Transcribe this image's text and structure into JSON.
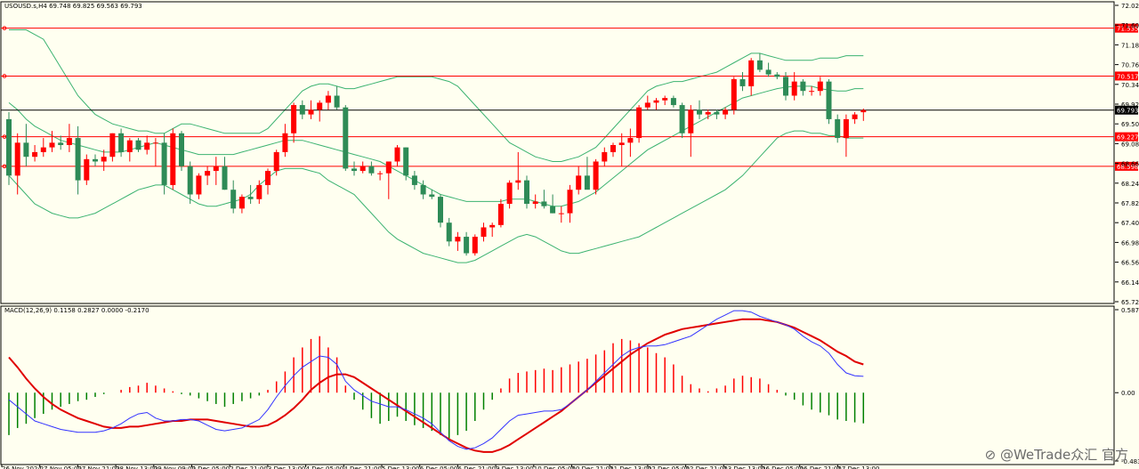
{
  "chart_data": {
    "type": "candlestick",
    "header": "USOUSD.s,H4  69.748 69.825 69.563 69.793",
    "colors": {
      "up": "#ff0000",
      "down": "#2e8b57",
      "bands": "#3cb371",
      "level": "#ff0000",
      "price_line": "#000000",
      "background": "#fffff0"
    },
    "price_axis": {
      "ylim": [
        65.72,
        72.02
      ],
      "ticks": [
        "72.020",
        "71.600",
        "71.180",
        "70.760",
        "70.340",
        "69.920",
        "69.500",
        "69.080",
        "68.660",
        "68.240",
        "67.820",
        "67.400",
        "66.980",
        "66.560",
        "66.140",
        "65.720"
      ]
    },
    "levels": [
      71.535,
      70.517,
      69.227,
      68.598
    ],
    "level_labels": [
      "71.535",
      "70.517",
      "69.227",
      "68.598"
    ],
    "last_price": 69.793,
    "last_price_label": "69.793",
    "x_labels": [
      "26 Nov 2024",
      "27 Nov 05:00",
      "27 Nov 21:00",
      "28 Nov 13:00",
      "29 Nov 09:00",
      "2 Dec 05:00",
      "2 Dec 21:00",
      "3 Dec 13:00",
      "4 Dec 05:00",
      "4 Dec 21:00",
      "5 Dec 13:00",
      "6 Dec 05:00",
      "6 Dec 21:00",
      "9 Dec 13:00",
      "10 Dec 05:00",
      "10 Dec 21:00",
      "11 Dec 13:00",
      "12 Dec 05:00",
      "12 Dec 21:00",
      "13 Dec 13:00",
      "16 Dec 05:00",
      "16 Dec 21:00",
      "17 Dec 13:00"
    ],
    "candles": [
      [
        69.6,
        69.75,
        68.2,
        68.4
      ],
      [
        68.4,
        69.3,
        68.0,
        69.1
      ],
      [
        69.1,
        69.5,
        68.6,
        68.8
      ],
      [
        68.8,
        69.05,
        68.7,
        68.9
      ],
      [
        68.9,
        69.2,
        68.8,
        69.0
      ],
      [
        69.0,
        69.35,
        68.9,
        69.1
      ],
      [
        69.1,
        69.25,
        68.95,
        69.05
      ],
      [
        69.05,
        69.5,
        68.9,
        69.2
      ],
      [
        69.2,
        69.45,
        68.0,
        68.3
      ],
      [
        68.3,
        68.85,
        68.2,
        68.75
      ],
      [
        68.75,
        68.85,
        68.6,
        68.7
      ],
      [
        68.7,
        68.95,
        68.5,
        68.8
      ],
      [
        68.8,
        69.3,
        68.7,
        69.3
      ],
      [
        69.3,
        69.4,
        68.8,
        68.9
      ],
      [
        68.9,
        69.2,
        68.7,
        69.15
      ],
      [
        69.15,
        69.2,
        68.9,
        68.95
      ],
      [
        68.95,
        69.25,
        68.85,
        69.1
      ],
      [
        69.1,
        69.2,
        68.6,
        69.1
      ],
      [
        69.1,
        69.3,
        68.0,
        68.2
      ],
      [
        68.2,
        69.4,
        68.1,
        69.3
      ],
      [
        69.3,
        69.35,
        68.5,
        68.6
      ],
      [
        68.6,
        68.7,
        67.8,
        68.0
      ],
      [
        68.0,
        68.45,
        67.9,
        68.4
      ],
      [
        68.4,
        68.6,
        68.2,
        68.5
      ],
      [
        68.5,
        68.8,
        68.2,
        68.6
      ],
      [
        68.6,
        68.8,
        68.1,
        68.1
      ],
      [
        68.1,
        68.3,
        67.6,
        67.7
      ],
      [
        67.7,
        68.0,
        67.6,
        67.95
      ],
      [
        67.95,
        68.2,
        67.8,
        67.9
      ],
      [
        67.9,
        68.3,
        67.8,
        68.2
      ],
      [
        68.2,
        68.55,
        68.0,
        68.5
      ],
      [
        68.5,
        68.95,
        68.4,
        68.9
      ],
      [
        68.9,
        69.5,
        68.8,
        69.3
      ],
      [
        69.3,
        69.95,
        69.1,
        69.9
      ],
      [
        69.9,
        70.0,
        69.6,
        69.7
      ],
      [
        69.7,
        70.0,
        69.6,
        69.8
      ],
      [
        69.8,
        70.0,
        69.55,
        69.95
      ],
      [
        69.95,
        70.2,
        69.8,
        70.1
      ],
      [
        70.1,
        70.3,
        69.8,
        69.85
      ],
      [
        69.85,
        69.9,
        68.5,
        68.55
      ],
      [
        68.55,
        68.7,
        68.4,
        68.5
      ],
      [
        68.5,
        68.7,
        68.45,
        68.6
      ],
      [
        68.6,
        68.7,
        68.4,
        68.45
      ],
      [
        68.45,
        68.5,
        68.3,
        68.45
      ],
      [
        68.45,
        68.6,
        67.9,
        68.7
      ],
      [
        68.7,
        69.05,
        68.6,
        69.0
      ],
      [
        69.0,
        69.0,
        68.3,
        68.4
      ],
      [
        68.4,
        68.5,
        68.1,
        68.2
      ],
      [
        68.2,
        68.3,
        67.9,
        68.0
      ],
      [
        68.0,
        68.1,
        67.9,
        67.95
      ],
      [
        67.95,
        68.0,
        67.3,
        67.4
      ],
      [
        67.4,
        67.5,
        66.9,
        67.0
      ],
      [
        67.0,
        67.2,
        66.8,
        67.1
      ],
      [
        67.1,
        67.2,
        66.7,
        66.75
      ],
      [
        66.75,
        67.15,
        66.7,
        67.1
      ],
      [
        67.1,
        67.4,
        67.0,
        67.3
      ],
      [
        67.3,
        67.4,
        67.1,
        67.35
      ],
      [
        67.35,
        67.9,
        67.3,
        67.8
      ],
      [
        67.8,
        68.3,
        67.7,
        68.25
      ],
      [
        68.25,
        68.9,
        68.1,
        68.3
      ],
      [
        68.3,
        68.4,
        67.7,
        67.8
      ],
      [
        67.8,
        68.0,
        67.7,
        67.85
      ],
      [
        67.85,
        68.1,
        67.7,
        67.75
      ],
      [
        67.75,
        68.0,
        67.6,
        67.6
      ],
      [
        67.6,
        67.75,
        67.4,
        67.6
      ],
      [
        67.6,
        68.2,
        67.4,
        68.1
      ],
      [
        68.1,
        68.6,
        68.0,
        68.4
      ],
      [
        68.4,
        68.8,
        68.2,
        68.1
      ],
      [
        68.1,
        68.75,
        68.0,
        68.7
      ],
      [
        68.7,
        69.0,
        68.6,
        68.9
      ],
      [
        68.9,
        69.1,
        68.8,
        69.05
      ],
      [
        69.05,
        69.3,
        68.6,
        69.1
      ],
      [
        69.1,
        69.4,
        68.8,
        69.2
      ],
      [
        69.2,
        69.9,
        69.1,
        69.85
      ],
      [
        69.85,
        70.1,
        69.8,
        69.95
      ],
      [
        69.95,
        70.05,
        69.8,
        70.0
      ],
      [
        70.0,
        70.1,
        69.9,
        70.05
      ],
      [
        70.05,
        70.1,
        69.85,
        69.9
      ],
      [
        69.9,
        69.95,
        69.2,
        69.3
      ],
      [
        69.3,
        69.9,
        68.8,
        69.8
      ],
      [
        69.8,
        70.0,
        69.6,
        69.7
      ],
      [
        69.7,
        69.8,
        69.6,
        69.75
      ],
      [
        69.75,
        69.8,
        69.6,
        69.7
      ],
      [
        69.7,
        69.85,
        69.6,
        69.8
      ],
      [
        69.8,
        70.5,
        69.7,
        70.45
      ],
      [
        70.45,
        70.6,
        70.2,
        70.3
      ],
      [
        70.3,
        70.9,
        70.1,
        70.85
      ],
      [
        70.85,
        71.0,
        70.6,
        70.65
      ],
      [
        70.65,
        70.8,
        70.5,
        70.55
      ],
      [
        70.55,
        70.6,
        70.45,
        70.5
      ],
      [
        70.5,
        70.6,
        70.0,
        70.1
      ],
      [
        70.1,
        70.6,
        70.0,
        70.4
      ],
      [
        70.4,
        70.45,
        70.1,
        70.2
      ],
      [
        70.2,
        70.3,
        70.1,
        70.2
      ],
      [
        70.2,
        70.5,
        70.1,
        70.4
      ],
      [
        70.4,
        70.45,
        69.5,
        69.6
      ],
      [
        69.6,
        69.7,
        69.1,
        69.2
      ],
      [
        69.2,
        69.7,
        68.8,
        69.6
      ],
      [
        69.6,
        69.75,
        69.5,
        69.7
      ],
      [
        69.748,
        69.825,
        69.563,
        69.793
      ]
    ],
    "bollinger": {
      "upper": [
        71.5,
        71.5,
        71.5,
        71.4,
        71.3,
        71.0,
        70.7,
        70.4,
        70.1,
        69.9,
        69.7,
        69.6,
        69.5,
        69.45,
        69.4,
        69.35,
        69.35,
        69.3,
        69.3,
        69.4,
        69.5,
        69.5,
        69.45,
        69.4,
        69.35,
        69.3,
        69.3,
        69.3,
        69.3,
        69.3,
        69.4,
        69.6,
        69.8,
        70.0,
        70.2,
        70.3,
        70.35,
        70.35,
        70.3,
        70.25,
        70.25,
        70.3,
        70.35,
        70.4,
        70.45,
        70.5,
        70.5,
        70.5,
        70.5,
        70.5,
        70.45,
        70.4,
        70.3,
        70.1,
        69.9,
        69.7,
        69.5,
        69.3,
        69.1,
        69.0,
        68.9,
        68.8,
        68.75,
        68.7,
        68.7,
        68.75,
        68.8,
        68.9,
        69.0,
        69.2,
        69.4,
        69.6,
        69.8,
        70.0,
        70.2,
        70.3,
        70.35,
        70.4,
        70.4,
        70.45,
        70.5,
        70.55,
        70.6,
        70.7,
        70.8,
        70.9,
        71.0,
        71.0,
        70.95,
        70.9,
        70.85,
        70.85,
        70.85,
        70.85,
        70.9,
        70.9,
        70.9,
        70.95,
        70.95,
        70.95
      ],
      "middle": [
        69.95,
        69.8,
        69.6,
        69.45,
        69.35,
        69.25,
        69.15,
        69.1,
        69.05,
        69.0,
        68.95,
        68.9,
        68.9,
        68.9,
        68.95,
        69.0,
        69.05,
        69.1,
        69.05,
        69.0,
        68.95,
        68.9,
        68.85,
        68.85,
        68.85,
        68.85,
        68.85,
        68.9,
        68.95,
        69.0,
        69.05,
        69.1,
        69.15,
        69.15,
        69.15,
        69.1,
        69.05,
        69.0,
        68.95,
        68.9,
        68.85,
        68.8,
        68.75,
        68.7,
        68.6,
        68.5,
        68.4,
        68.3,
        68.2,
        68.1,
        68.0,
        67.95,
        67.9,
        67.85,
        67.85,
        67.85,
        67.85,
        67.85,
        67.9,
        67.9,
        67.9,
        67.85,
        67.8,
        67.75,
        67.75,
        67.8,
        67.85,
        67.95,
        68.05,
        68.2,
        68.35,
        68.5,
        68.65,
        68.8,
        68.95,
        69.05,
        69.15,
        69.25,
        69.35,
        69.45,
        69.55,
        69.65,
        69.75,
        69.85,
        69.95,
        70.05,
        70.1,
        70.15,
        70.2,
        70.25,
        70.28,
        70.3,
        70.3,
        70.3,
        70.25,
        70.22,
        70.2,
        70.2,
        70.25,
        70.25
      ],
      "lower": [
        68.4,
        68.2,
        68.0,
        67.8,
        67.7,
        67.6,
        67.55,
        67.5,
        67.5,
        67.55,
        67.6,
        67.7,
        67.8,
        67.9,
        68.0,
        68.1,
        68.15,
        68.2,
        68.2,
        68.1,
        68.0,
        67.9,
        67.8,
        67.75,
        67.75,
        67.8,
        67.85,
        67.9,
        68.0,
        68.2,
        68.35,
        68.5,
        68.55,
        68.55,
        68.55,
        68.5,
        68.45,
        68.3,
        68.2,
        68.1,
        68.0,
        67.8,
        67.6,
        67.4,
        67.2,
        67.05,
        66.95,
        66.85,
        66.75,
        66.7,
        66.65,
        66.6,
        66.55,
        66.55,
        66.6,
        66.7,
        66.8,
        66.9,
        67.0,
        67.1,
        67.15,
        67.1,
        67.0,
        66.9,
        66.8,
        66.75,
        66.75,
        66.8,
        66.85,
        66.9,
        66.95,
        67.0,
        67.05,
        67.1,
        67.2,
        67.3,
        67.4,
        67.5,
        67.6,
        67.7,
        67.8,
        67.9,
        68.0,
        68.1,
        68.25,
        68.4,
        68.6,
        68.8,
        69.0,
        69.2,
        69.3,
        69.35,
        69.35,
        69.3,
        69.3,
        69.25,
        69.25,
        69.2,
        69.2,
        69.2
      ]
    },
    "macd": {
      "header": "MACD(12,26,9) 0.1158 0.2827 0.0000 -0.2170",
      "ylim": [
        -0.4834,
        0.5872
      ],
      "ticks": [
        "0.5872",
        "0.00",
        "-0.4834"
      ],
      "histogram": [
        -0.3,
        -0.25,
        -0.22,
        -0.18,
        -0.15,
        -0.12,
        -0.1,
        -0.08,
        -0.06,
        -0.05,
        -0.03,
        -0.01,
        0.0,
        0.02,
        0.04,
        0.05,
        0.07,
        0.05,
        0.03,
        0.01,
        -0.01,
        -0.02,
        -0.04,
        -0.06,
        -0.08,
        -0.1,
        -0.08,
        -0.06,
        -0.04,
        -0.02,
        0.02,
        0.08,
        0.15,
        0.25,
        0.32,
        0.38,
        0.4,
        0.32,
        0.25,
        0.05,
        -0.05,
        -0.12,
        -0.18,
        -0.22,
        -0.2,
        -0.17,
        -0.2,
        -0.23,
        -0.25,
        -0.27,
        -0.3,
        -0.33,
        -0.3,
        -0.27,
        -0.2,
        -0.12,
        -0.05,
        0.03,
        0.1,
        0.14,
        0.15,
        0.16,
        0.17,
        0.16,
        0.18,
        0.2,
        0.22,
        0.24,
        0.27,
        0.3,
        0.35,
        0.38,
        0.37,
        0.35,
        0.32,
        0.28,
        0.25,
        0.2,
        0.12,
        0.06,
        0.03,
        0.01,
        0.03,
        0.05,
        0.1,
        0.12,
        0.11,
        0.1,
        0.06,
        0.02,
        -0.02,
        -0.05,
        -0.09,
        -0.12,
        -0.14,
        -0.16,
        -0.19,
        -0.2,
        -0.21,
        -0.217
      ],
      "macd_line": [
        -0.05,
        -0.1,
        -0.15,
        -0.2,
        -0.22,
        -0.24,
        -0.26,
        -0.27,
        -0.28,
        -0.28,
        -0.28,
        -0.27,
        -0.25,
        -0.22,
        -0.18,
        -0.15,
        -0.14,
        -0.18,
        -0.2,
        -0.2,
        -0.19,
        -0.19,
        -0.2,
        -0.23,
        -0.26,
        -0.27,
        -0.26,
        -0.25,
        -0.22,
        -0.19,
        -0.12,
        -0.03,
        0.05,
        0.12,
        0.18,
        0.22,
        0.26,
        0.25,
        0.2,
        0.08,
        0.02,
        -0.02,
        -0.06,
        -0.08,
        -0.1,
        -0.1,
        -0.12,
        -0.15,
        -0.18,
        -0.22,
        -0.28,
        -0.34,
        -0.38,
        -0.4,
        -0.39,
        -0.36,
        -0.32,
        -0.26,
        -0.2,
        -0.16,
        -0.15,
        -0.14,
        -0.13,
        -0.13,
        -0.12,
        -0.08,
        -0.03,
        0.02,
        0.08,
        0.14,
        0.2,
        0.26,
        0.3,
        0.32,
        0.33,
        0.33,
        0.34,
        0.36,
        0.38,
        0.4,
        0.44,
        0.48,
        0.52,
        0.55,
        0.58,
        0.58,
        0.57,
        0.54,
        0.52,
        0.5,
        0.48,
        0.45,
        0.4,
        0.36,
        0.33,
        0.28,
        0.2,
        0.14,
        0.12,
        0.1158
      ],
      "signal_line": [
        0.25,
        0.18,
        0.1,
        0.03,
        -0.03,
        -0.08,
        -0.12,
        -0.15,
        -0.18,
        -0.2,
        -0.22,
        -0.24,
        -0.25,
        -0.25,
        -0.24,
        -0.24,
        -0.23,
        -0.22,
        -0.21,
        -0.2,
        -0.2,
        -0.19,
        -0.19,
        -0.19,
        -0.2,
        -0.21,
        -0.22,
        -0.23,
        -0.24,
        -0.24,
        -0.23,
        -0.2,
        -0.16,
        -0.11,
        -0.05,
        0.02,
        0.07,
        0.11,
        0.13,
        0.13,
        0.11,
        0.07,
        0.03,
        -0.01,
        -0.05,
        -0.09,
        -0.13,
        -0.17,
        -0.21,
        -0.25,
        -0.29,
        -0.33,
        -0.36,
        -0.39,
        -0.41,
        -0.42,
        -0.42,
        -0.4,
        -0.37,
        -0.33,
        -0.29,
        -0.25,
        -0.21,
        -0.17,
        -0.13,
        -0.08,
        -0.03,
        0.02,
        0.07,
        0.12,
        0.17,
        0.22,
        0.27,
        0.31,
        0.35,
        0.38,
        0.41,
        0.43,
        0.45,
        0.46,
        0.47,
        0.48,
        0.49,
        0.5,
        0.51,
        0.52,
        0.52,
        0.52,
        0.51,
        0.5,
        0.48,
        0.46,
        0.43,
        0.4,
        0.37,
        0.33,
        0.29,
        0.26,
        0.22,
        0.2
      ]
    }
  },
  "watermark": "⊘ @WeTrade众汇 官方"
}
